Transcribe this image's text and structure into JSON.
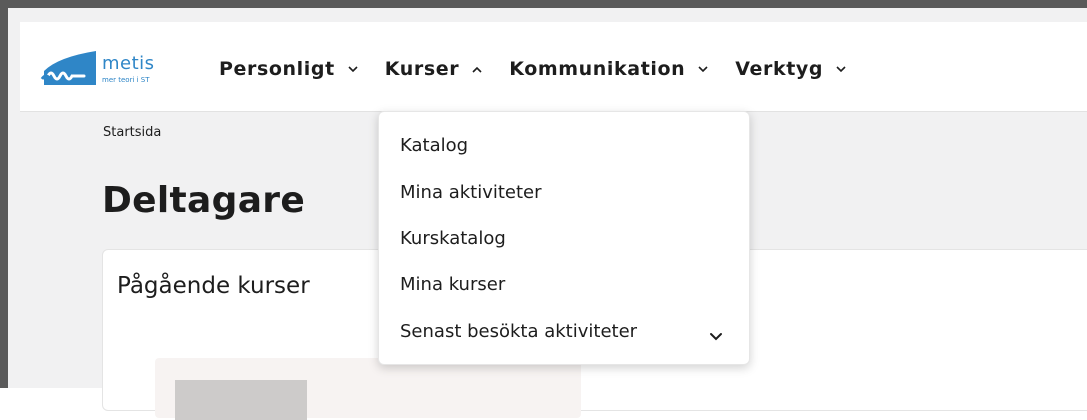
{
  "logo": {
    "word": "metis",
    "tagline": "mer teori i ST",
    "color": "#2f86c7"
  },
  "nav": {
    "items": [
      {
        "label": "Personligt",
        "chevron": "chevron-down-icon"
      },
      {
        "label": "Kurser",
        "chevron": "chevron-up-icon"
      },
      {
        "label": "Kommunikation",
        "chevron": "chevron-down-icon"
      },
      {
        "label": "Verktyg",
        "chevron": "chevron-down-icon"
      }
    ]
  },
  "breadcrumb": {
    "items": [
      "Startsida"
    ]
  },
  "page": {
    "title": "Deltagare"
  },
  "card": {
    "title": "Pågående kurser"
  },
  "dropdown": {
    "items": [
      {
        "label": "Katalog"
      },
      {
        "label": "Mina aktiviteter"
      },
      {
        "label": "Kurskatalog"
      },
      {
        "label": "Mina kurser"
      },
      {
        "label": "Senast besökta aktiviteter",
        "chevron": "chevron-down-icon"
      }
    ]
  }
}
